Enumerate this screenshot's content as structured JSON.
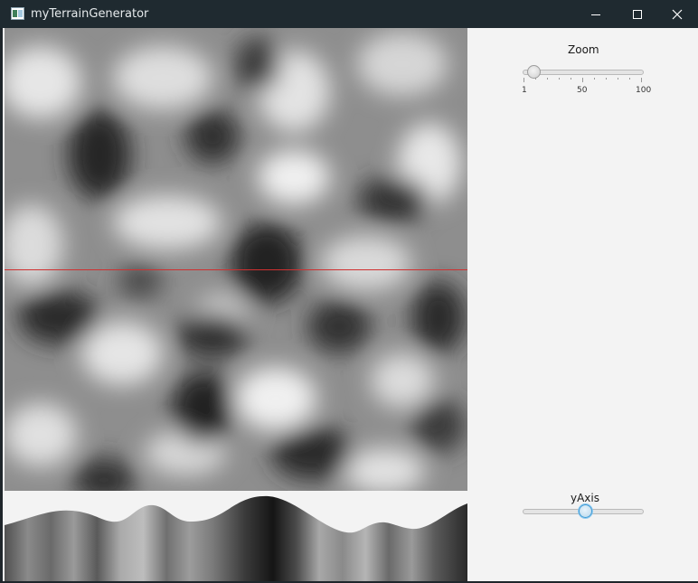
{
  "window": {
    "title": "myTerrainGenerator",
    "controls": {
      "minimize": "minimize",
      "maximize": "maximize",
      "close": "close"
    }
  },
  "canvas": {
    "scanline_color": "#d03030"
  },
  "side_panel": {
    "zoom": {
      "label": "Zoom",
      "min": 1,
      "max": 100,
      "value": 1,
      "tick_labels": [
        "1",
        "50",
        "100"
      ]
    },
    "yaxis": {
      "label": "yAxis",
      "value_fraction": 0.52
    }
  },
  "colors": {
    "titlebar": "#1f2a30",
    "panel_bg": "#f3f3f3",
    "accent": "#3d9bd6"
  }
}
